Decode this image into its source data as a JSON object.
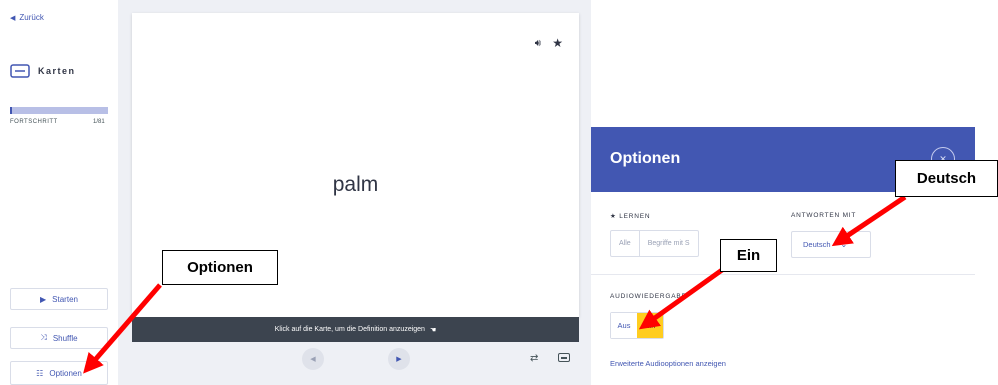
{
  "sidebar": {
    "back_label": "Zurück",
    "mode_label": "Karten",
    "progress_label": "FORTSCHRITT",
    "progress_count": "1/81",
    "progress_fraction": 0.0123,
    "buttons": {
      "start": "Starten",
      "shuffle": "Shuffle",
      "options": "Optionen"
    }
  },
  "card": {
    "term": "palm",
    "hint": "Klick auf die Karte, um die Definition anzuzeigen"
  },
  "options_panel": {
    "title": "Optionen",
    "learn_label": "★ LERNEN",
    "learn_options": [
      "Alle",
      "Begriffe mit S"
    ],
    "answer_label": "ANTWORTEN MIT",
    "answer_value": "Deutsch",
    "audio_label": "AUDIOWIEDERGABE",
    "audio_off": "Aus",
    "audio_on": "Ein",
    "audio_link": "Erweiterte Audiooptionen anzeigen"
  },
  "callouts": {
    "options": "Optionen",
    "deutsch": "Deutsch",
    "ein": "Ein"
  },
  "colors": {
    "accent": "#4257b2",
    "highlight": "#ffcd1f",
    "arrow": "#ff0000"
  }
}
